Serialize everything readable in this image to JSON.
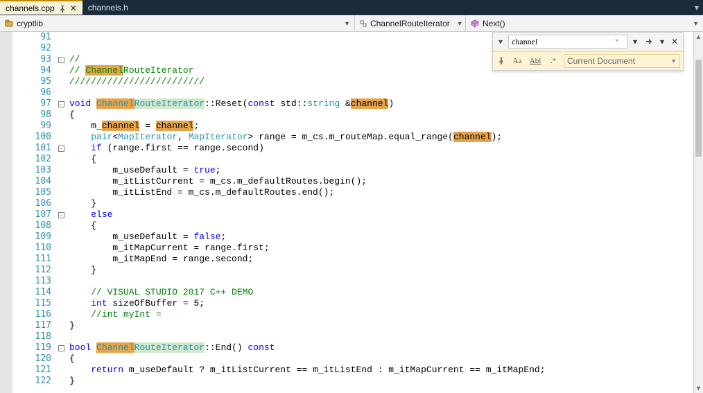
{
  "tabs": {
    "active": {
      "label": "channels.cpp"
    },
    "other": {
      "label": "channels.h"
    }
  },
  "navbar": {
    "project": "cryptlib",
    "class": "ChannelRouteIterator",
    "func": "Next()"
  },
  "find": {
    "term": "channel",
    "scope": "Current Document",
    "options": {
      "match_case_label": "Aa",
      "whole_word_label": "Abl",
      "regex_label": ".*"
    }
  },
  "lines": [
    {
      "n": 91,
      "fold": "",
      "html": ""
    },
    {
      "n": 92,
      "fold": "",
      "html": ""
    },
    {
      "n": 93,
      "fold": "-",
      "html": "<span class='c-cmt'>//</span>"
    },
    {
      "n": 94,
      "fold": "",
      "html": "<span class='c-cmt'>// <span class='hl-sh'>Channel</span>RouteIterator</span>"
    },
    {
      "n": 95,
      "fold": "",
      "html": "<span class='c-cmt'>/////////////////////////</span>"
    },
    {
      "n": 96,
      "fold": "",
      "html": ""
    },
    {
      "n": 97,
      "fold": "-",
      "html": "<span class='c-kw'>void</span> <span class='hl-sh c-cls'>Channel</span><span class='hl-sel c-cls'>RouteIterator</span><span class='c-punct'>::</span><span class='c-id'>Reset</span>(<span class='c-kw'>const</span> <span class='c-id'>std</span>::<span class='c-cls'>string</span> &amp;<span class='hl-sh'>channel</span>)"
    },
    {
      "n": 98,
      "fold": "",
      "html": "{"
    },
    {
      "n": 99,
      "fold": "",
      "html": "    m_<span class='hl-sh'>channel</span> = <span class='hl-sh'>channel</span>;"
    },
    {
      "n": 100,
      "fold": "",
      "html": "    <span class='c-cls'>pair</span>&lt;<span class='c-cls'>MapIterator</span>, <span class='c-cls'>MapIterator</span>&gt; range = m_cs.m_routeMap.equal_range(<span class='hl-sh'>channel</span>);"
    },
    {
      "n": 101,
      "fold": "-",
      "html": "    <span class='c-kw'>if</span> (range.first == range.second)"
    },
    {
      "n": 102,
      "fold": "",
      "html": "    {"
    },
    {
      "n": 103,
      "fold": "",
      "html": "        m_useDefault = <span class='c-kw'>true</span>;"
    },
    {
      "n": 104,
      "fold": "",
      "html": "        m_itListCurrent = m_cs.m_defaultRoutes.begin();"
    },
    {
      "n": 105,
      "fold": "",
      "html": "        m_itListEnd = m_cs.m_defaultRoutes.end();"
    },
    {
      "n": 106,
      "fold": "",
      "html": "    }"
    },
    {
      "n": 107,
      "fold": "-",
      "html": "    <span class='c-kw'>else</span>"
    },
    {
      "n": 108,
      "fold": "",
      "html": "    {"
    },
    {
      "n": 109,
      "fold": "",
      "html": "        m_useDefault = <span class='c-kw'>false</span>;"
    },
    {
      "n": 110,
      "fold": "",
      "html": "        m_itMapCurrent = range.first;"
    },
    {
      "n": 111,
      "fold": "",
      "html": "        m_itMapEnd = range.second;"
    },
    {
      "n": 112,
      "fold": "",
      "html": "    }"
    },
    {
      "n": 113,
      "fold": "",
      "html": ""
    },
    {
      "n": 114,
      "fold": "",
      "html": "    <span class='c-cmt'>// VISUAL STUDIO 2017 C++ DEMO</span>"
    },
    {
      "n": 115,
      "fold": "",
      "html": "    <span class='c-kw'>int</span> sizeOfBuffer = 5;"
    },
    {
      "n": 116,
      "fold": "",
      "html": "    <span class='c-cmt'>//int myInt = </span>"
    },
    {
      "n": 117,
      "fold": "",
      "html": "}"
    },
    {
      "n": 118,
      "fold": "",
      "html": ""
    },
    {
      "n": 119,
      "fold": "-",
      "html": "<span class='c-kw'>bool</span> <span class='hl-sh c-cls'>Channel</span><span class='hl-sel c-cls'>RouteIterator</span><span class='c-punct'>::</span>End() <span class='c-kw'>const</span>"
    },
    {
      "n": 120,
      "fold": "",
      "html": "{"
    },
    {
      "n": 121,
      "fold": "",
      "html": "    <span class='c-kw'>return</span> m_useDefault ? m_itListCurrent == m_itListEnd : m_itMapCurrent == m_itMapEnd;"
    },
    {
      "n": 122,
      "fold": "",
      "html": "}"
    }
  ]
}
